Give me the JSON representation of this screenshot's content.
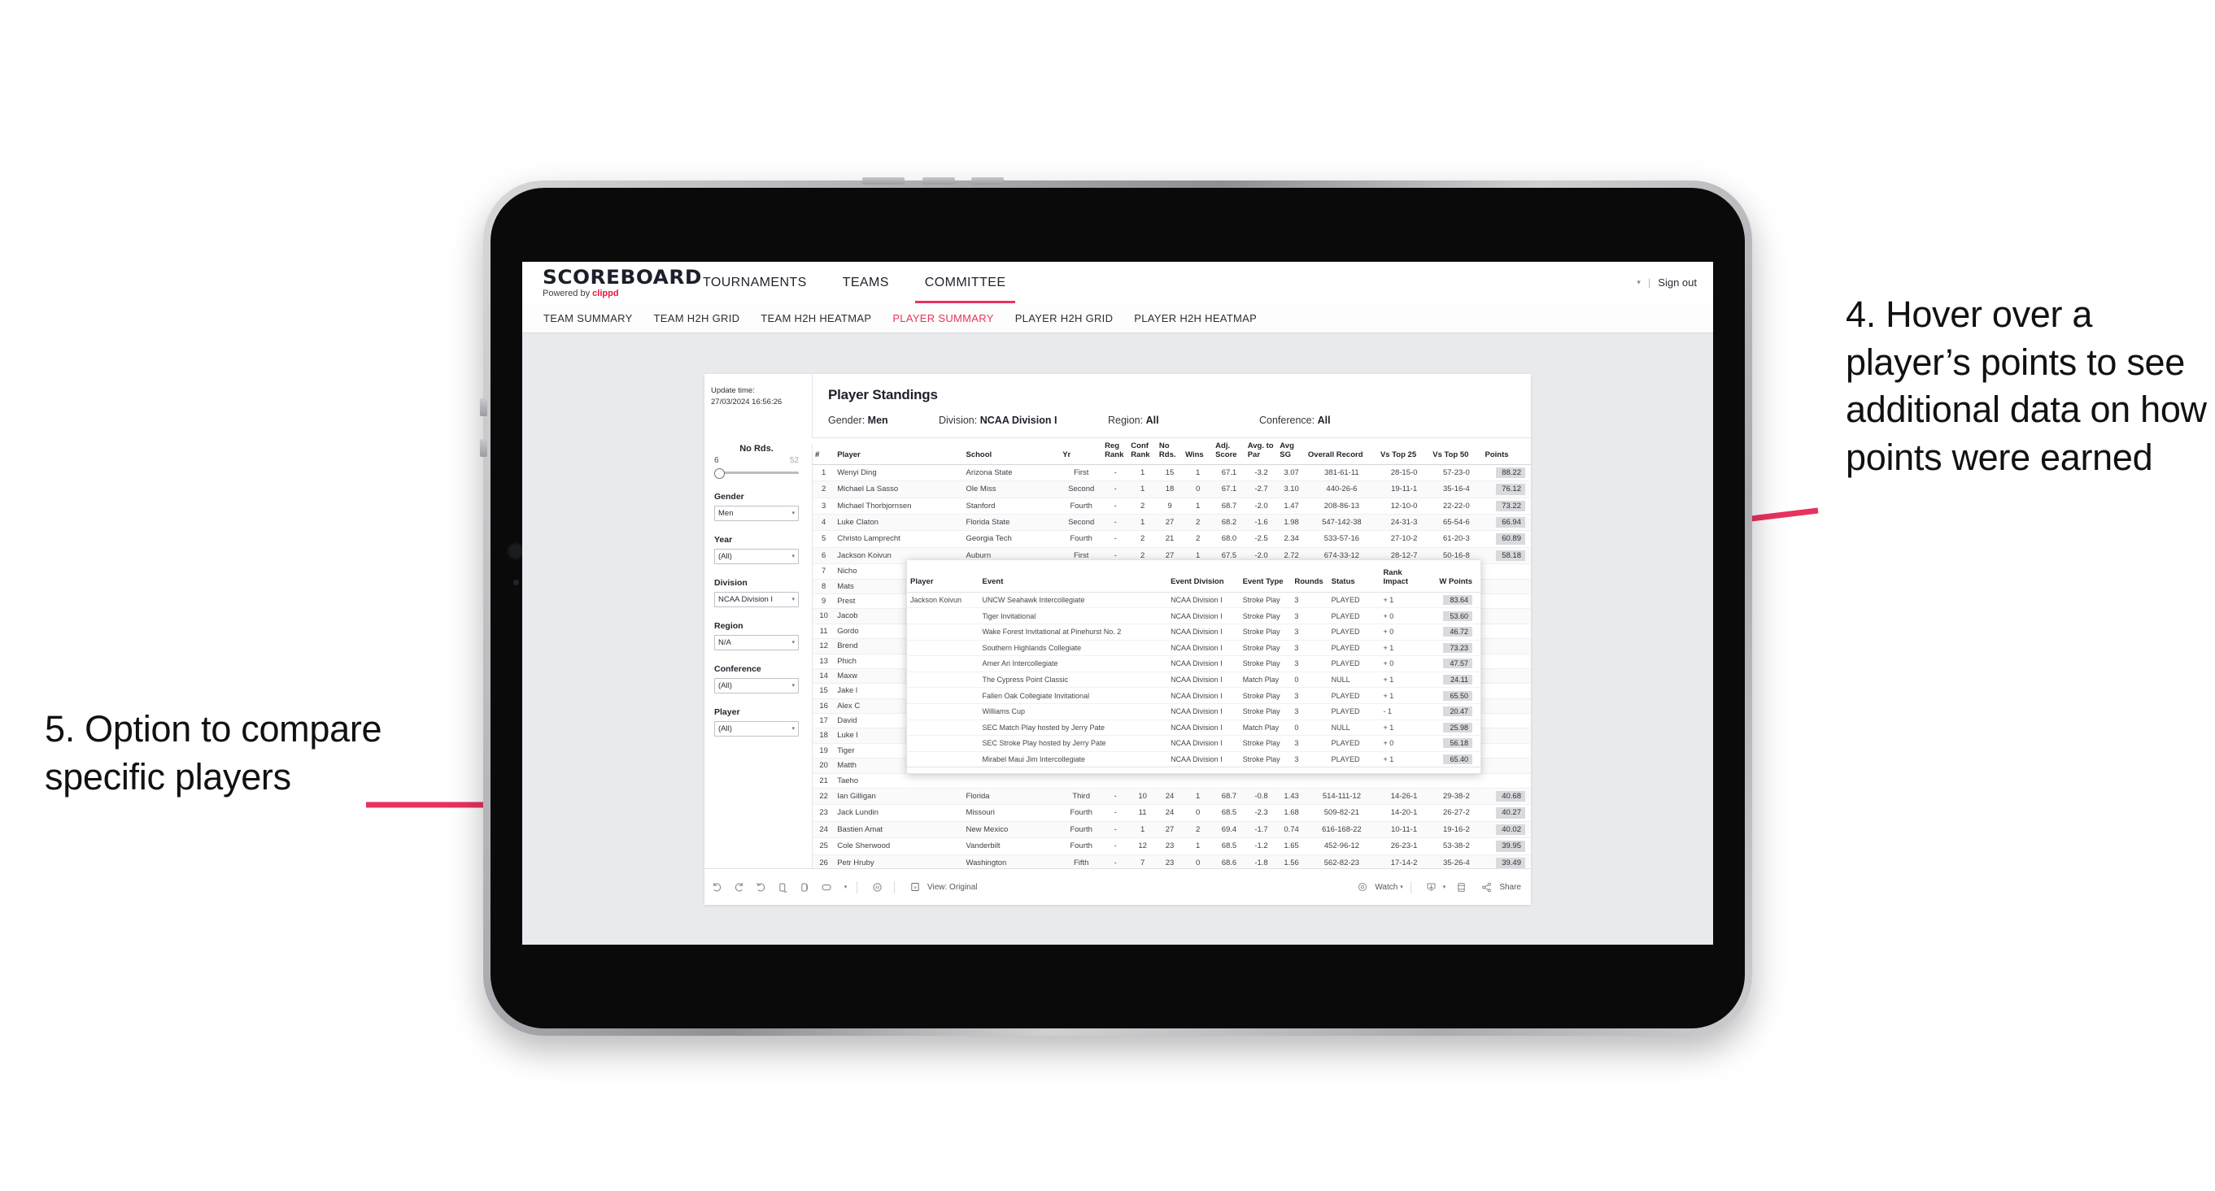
{
  "annotations": {
    "right": "4. Hover over a player’s points to see additional data on how points were earned",
    "left": "5. Option to compare specific players",
    "accent_color": "#e8325f"
  },
  "app": {
    "logo_word": "SCOREBOARD",
    "logo_sub_prefix": "Powered by ",
    "logo_sub_brand": "clippd",
    "top_nav": [
      {
        "label": "TOURNAMENTS",
        "active": false
      },
      {
        "label": "TEAMS",
        "active": false
      },
      {
        "label": "COMMITTEE",
        "active": true
      }
    ],
    "account": {
      "caret": "▾",
      "divider": "|",
      "sign_out": "Sign out"
    },
    "sub_nav": [
      {
        "label": "TEAM SUMMARY",
        "active": false
      },
      {
        "label": "TEAM H2H GRID",
        "active": false
      },
      {
        "label": "TEAM H2H HEATMAP",
        "active": false
      },
      {
        "label": "PLAYER SUMMARY",
        "active": true
      },
      {
        "label": "PLAYER H2H GRID",
        "active": false
      },
      {
        "label": "PLAYER H2H HEATMAP",
        "active": false
      }
    ]
  },
  "viz": {
    "update_label": "Update time:",
    "update_value": "27/03/2024 16:56:26",
    "title": "Player Standings",
    "filter_summary": [
      {
        "key": "Gender:",
        "value": "Men"
      },
      {
        "key": "Division:",
        "value": "NCAA Division I"
      },
      {
        "key": "Region:",
        "value": "All"
      },
      {
        "key": "Conference:",
        "value": "All"
      }
    ]
  },
  "rail": {
    "rounds": {
      "label": "No Rds.",
      "min": "6",
      "max": "52"
    },
    "filters": [
      {
        "label": "Gender",
        "value": "Men",
        "caret": "▾"
      },
      {
        "label": "Year",
        "value": "(All)",
        "caret": "▾"
      },
      {
        "label": "Division",
        "value": "NCAA Division I",
        "caret": "▾"
      },
      {
        "label": "Region",
        "value": "N/A",
        "caret": "▾"
      },
      {
        "label": "Conference",
        "value": "(All)",
        "caret": "▾"
      },
      {
        "label": "Player",
        "value": "(All)",
        "caret": "▾"
      }
    ]
  },
  "table": {
    "columns": [
      "#",
      "Player",
      "School",
      "Yr",
      "Reg Rank",
      "Conf Rank",
      "No Rds.",
      "Wins",
      "Adj. Score",
      "Avg. to Par",
      "Avg SG",
      "Overall Record",
      "Vs Top 25",
      "Vs Top 50",
      "Points"
    ],
    "rows": [
      [
        "1",
        "Wenyi Ding",
        "Arizona State",
        "First",
        "-",
        "1",
        "15",
        "1",
        "67.1",
        "-3.2",
        "3.07",
        "381-61-11",
        "28-15-0",
        "57-23-0",
        "88.22"
      ],
      [
        "2",
        "Michael La Sasso",
        "Ole Miss",
        "Second",
        "-",
        "1",
        "18",
        "0",
        "67.1",
        "-2.7",
        "3.10",
        "440-26-6",
        "19-11-1",
        "35-16-4",
        "76.12"
      ],
      [
        "3",
        "Michael Thorbjornsen",
        "Stanford",
        "Fourth",
        "-",
        "2",
        "9",
        "1",
        "68.7",
        "-2.0",
        "1.47",
        "208-86-13",
        "12-10-0",
        "22-22-0",
        "73.22"
      ],
      [
        "4",
        "Luke Claton",
        "Florida State",
        "Second",
        "-",
        "1",
        "27",
        "2",
        "68.2",
        "-1.6",
        "1.98",
        "547-142-38",
        "24-31-3",
        "65-54-6",
        "66.94"
      ],
      [
        "5",
        "Christo Lamprecht",
        "Georgia Tech",
        "Fourth",
        "-",
        "2",
        "21",
        "2",
        "68.0",
        "-2.5",
        "2.34",
        "533-57-16",
        "27-10-2",
        "61-20-3",
        "60.89"
      ],
      [
        "6",
        "Jackson Koivun",
        "Auburn",
        "First",
        "-",
        "2",
        "27",
        "1",
        "67.5",
        "-2.0",
        "2.72",
        "674-33-12",
        "28-12-7",
        "50-16-8",
        "58.18"
      ],
      [
        "7",
        "Nicho",
        "",
        "",
        "",
        "",
        "",
        "",
        "",
        "",
        "",
        "",
        "",
        "",
        ""
      ],
      [
        "8",
        "Mats",
        "",
        "",
        "",
        "",
        "",
        "",
        "",
        "",
        "",
        "",
        "",
        "",
        ""
      ],
      [
        "9",
        "Prest",
        "",
        "",
        "",
        "",
        "",
        "",
        "",
        "",
        "",
        "",
        "",
        "",
        ""
      ],
      [
        "10",
        "Jacob",
        "",
        "",
        "",
        "",
        "",
        "",
        "",
        "",
        "",
        "",
        "",
        "",
        ""
      ],
      [
        "11",
        "Gordo",
        "",
        "",
        "",
        "",
        "",
        "",
        "",
        "",
        "",
        "",
        "",
        "",
        ""
      ],
      [
        "12",
        "Brend",
        "",
        "",
        "",
        "",
        "",
        "",
        "",
        "",
        "",
        "",
        "",
        "",
        ""
      ],
      [
        "13",
        "Phich",
        "",
        "",
        "",
        "",
        "",
        "",
        "",
        "",
        "",
        "",
        "",
        "",
        ""
      ],
      [
        "14",
        "Maxw",
        "",
        "",
        "",
        "",
        "",
        "",
        "",
        "",
        "",
        "",
        "",
        "",
        ""
      ],
      [
        "15",
        "Jake l",
        "",
        "",
        "",
        "",
        "",
        "",
        "",
        "",
        "",
        "",
        "",
        "",
        ""
      ],
      [
        "16",
        "Alex C",
        "",
        "",
        "",
        "",
        "",
        "",
        "",
        "",
        "",
        "",
        "",
        "",
        ""
      ],
      [
        "17",
        "David",
        "",
        "",
        "",
        "",
        "",
        "",
        "",
        "",
        "",
        "",
        "",
        "",
        ""
      ],
      [
        "18",
        "Luke l",
        "",
        "",
        "",
        "",
        "",
        "",
        "",
        "",
        "",
        "",
        "",
        "",
        ""
      ],
      [
        "19",
        "Tiger",
        "",
        "",
        "",
        "",
        "",
        "",
        "",
        "",
        "",
        "",
        "",
        "",
        ""
      ],
      [
        "20",
        "Matth",
        "",
        "",
        "",
        "",
        "",
        "",
        "",
        "",
        "",
        "",
        "",
        "",
        ""
      ],
      [
        "21",
        "Taeho",
        "",
        "",
        "",
        "",
        "",
        "",
        "",
        "",
        "",
        "",
        "",
        "",
        ""
      ],
      [
        "22",
        "Ian Gilligan",
        "Florida",
        "Third",
        "-",
        "10",
        "24",
        "1",
        "68.7",
        "-0.8",
        "1.43",
        "514-111-12",
        "14-26-1",
        "29-38-2",
        "40.68"
      ],
      [
        "23",
        "Jack Lundin",
        "Missouri",
        "Fourth",
        "-",
        "11",
        "24",
        "0",
        "68.5",
        "-2.3",
        "1.68",
        "509-82-21",
        "14-20-1",
        "26-27-2",
        "40.27"
      ],
      [
        "24",
        "Bastien Amat",
        "New Mexico",
        "Fourth",
        "-",
        "1",
        "27",
        "2",
        "69.4",
        "-1.7",
        "0.74",
        "616-168-22",
        "10-11-1",
        "19-16-2",
        "40.02"
      ],
      [
        "25",
        "Cole Sherwood",
        "Vanderbilt",
        "Fourth",
        "-",
        "12",
        "23",
        "1",
        "68.5",
        "-1.2",
        "1.65",
        "452-96-12",
        "26-23-1",
        "53-38-2",
        "39.95"
      ],
      [
        "26",
        "Petr Hruby",
        "Washington",
        "Fifth",
        "-",
        "7",
        "23",
        "0",
        "68.6",
        "-1.8",
        "1.56",
        "562-82-23",
        "17-14-2",
        "35-26-4",
        "39.49"
      ]
    ]
  },
  "tooltip": {
    "columns": [
      "Player",
      "Event",
      "Event Division",
      "Event Type",
      "Rounds",
      "Status",
      "Rank Impact",
      "W Points"
    ],
    "player": "Jackson Koivun",
    "rows": [
      [
        "UNCW Seahawk Intercollegiate",
        "NCAA Division I",
        "Stroke Play",
        "3",
        "PLAYED",
        "+ 1",
        "83.64"
      ],
      [
        "Tiger Invitational",
        "NCAA Division I",
        "Stroke Play",
        "3",
        "PLAYED",
        "+ 0",
        "53.60"
      ],
      [
        "Wake Forest Invitational at Pinehurst No. 2",
        "NCAA Division I",
        "Stroke Play",
        "3",
        "PLAYED",
        "+ 0",
        "46.72"
      ],
      [
        "Southern Highlands Collegiate",
        "NCAA Division I",
        "Stroke Play",
        "3",
        "PLAYED",
        "+ 1",
        "73.23"
      ],
      [
        "Amer Ari Intercollegiate",
        "NCAA Division I",
        "Stroke Play",
        "3",
        "PLAYED",
        "+ 0",
        "47.57"
      ],
      [
        "The Cypress Point Classic",
        "NCAA Division I",
        "Match Play",
        "0",
        "NULL",
        "+ 1",
        "24.11"
      ],
      [
        "Fallen Oak Collegiate Invitational",
        "NCAA Division I",
        "Stroke Play",
        "3",
        "PLAYED",
        "+ 1",
        "65.50"
      ],
      [
        "Williams Cup",
        "NCAA Division I",
        "Stroke Play",
        "3",
        "PLAYED",
        "- 1",
        "20.47"
      ],
      [
        "SEC Match Play hosted by Jerry Pate",
        "NCAA Division I",
        "Match Play",
        "0",
        "NULL",
        "+ 1",
        "25.98"
      ],
      [
        "SEC Stroke Play hosted by Jerry Pate",
        "NCAA Division I",
        "Stroke Play",
        "3",
        "PLAYED",
        "+ 0",
        "56.18"
      ],
      [
        "Mirabel Maui Jim Intercollegiate",
        "NCAA Division I",
        "Stroke Play",
        "3",
        "PLAYED",
        "+ 1",
        "65.40"
      ]
    ]
  },
  "toolbar": {
    "view_label": "View: Original",
    "watch_label": "Watch",
    "share_label": "Share",
    "caret": "▾"
  }
}
